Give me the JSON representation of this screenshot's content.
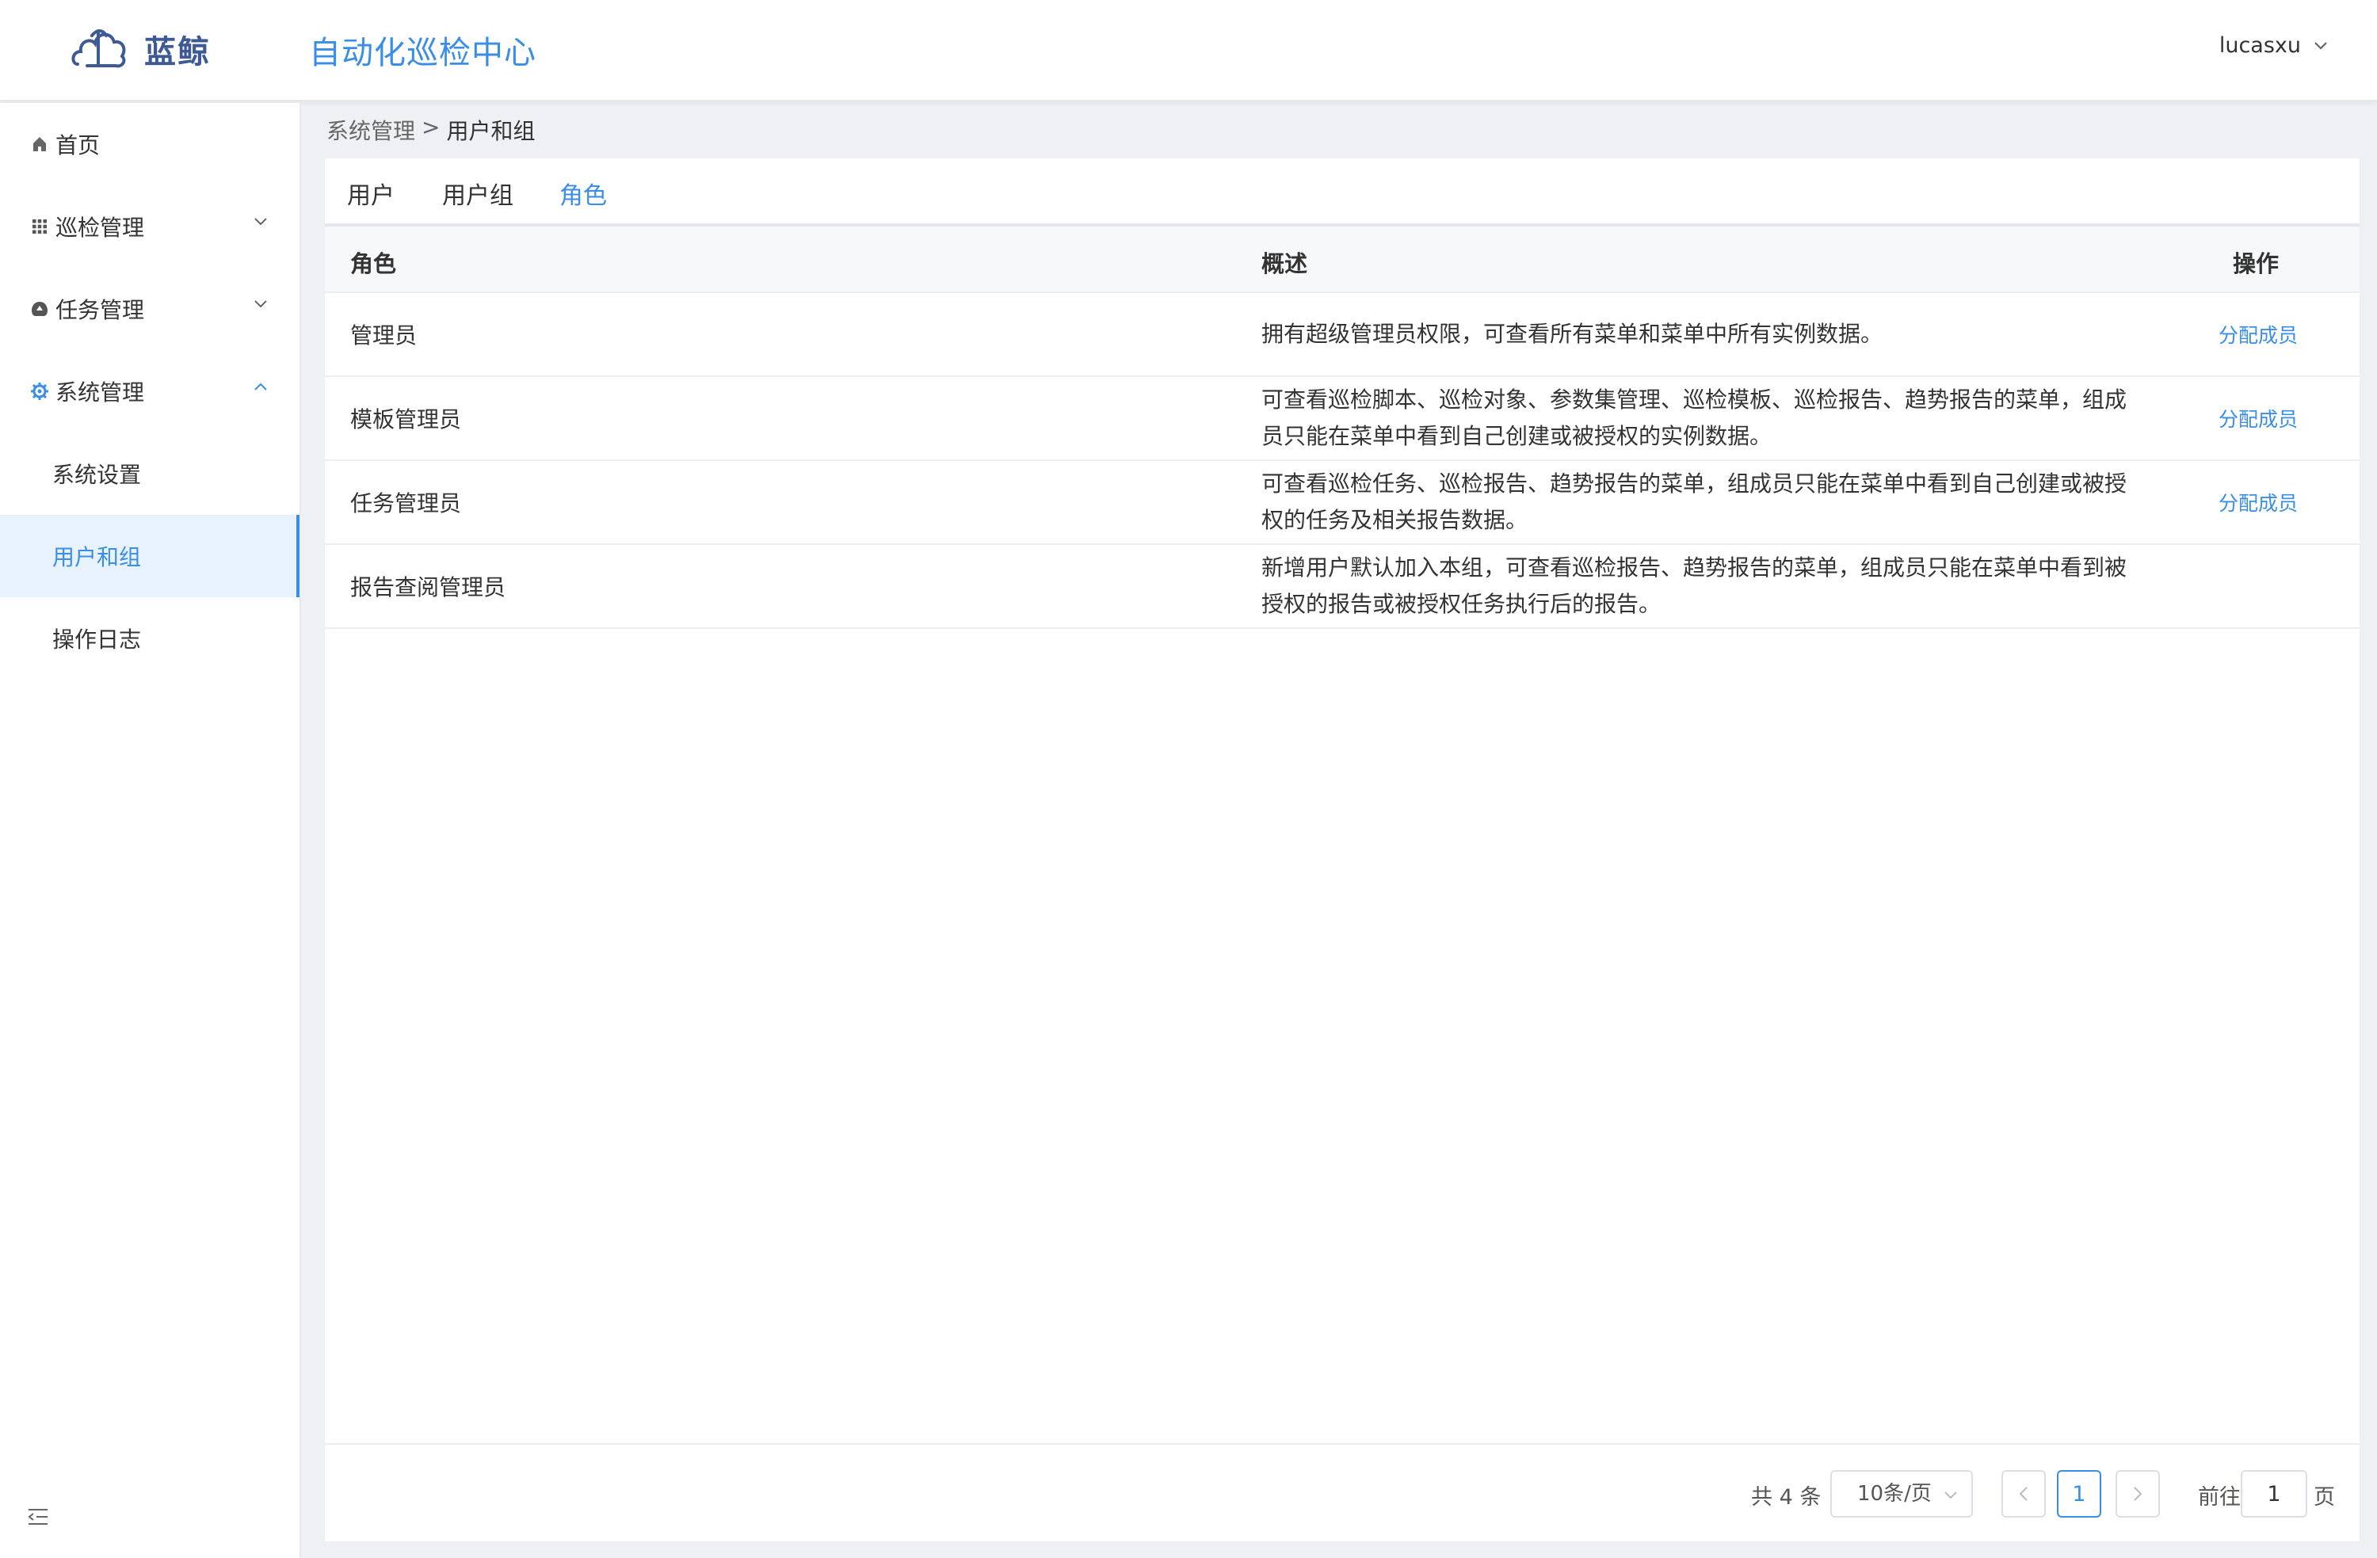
{
  "header": {
    "logo_text": "蓝鲸",
    "app_title": "自动化巡检中心",
    "username": "lucasxu"
  },
  "sidebar": {
    "items": [
      {
        "label": "首页",
        "icon": "home-icon"
      },
      {
        "label": "巡检管理",
        "icon": "grid-icon",
        "expanded": false
      },
      {
        "label": "任务管理",
        "icon": "task-icon",
        "expanded": false
      },
      {
        "label": "系统管理",
        "icon": "gear-icon",
        "expanded": true
      }
    ],
    "subitems": [
      {
        "label": "系统设置",
        "active": false
      },
      {
        "label": "用户和组",
        "active": true
      },
      {
        "label": "操作日志",
        "active": false
      }
    ]
  },
  "breadcrumb": {
    "parent": "系统管理",
    "separator": ">",
    "current": "用户和组"
  },
  "tabs": [
    {
      "label": "用户",
      "active": false
    },
    {
      "label": "用户组",
      "active": false
    },
    {
      "label": "角色",
      "active": true
    }
  ],
  "table": {
    "headers": {
      "role": "角色",
      "description": "概述",
      "action": "操作"
    },
    "rows": [
      {
        "role": "管理员",
        "description": "拥有超级管理员权限，可查看所有菜单和菜单中所有实例数据。",
        "action": "分配成员"
      },
      {
        "role": "模板管理员",
        "description": "可查看巡检脚本、巡检对象、参数集管理、巡检模板、巡检报告、趋势报告的菜单，组成员只能在菜单中看到自己创建或被授权的实例数据。",
        "action": "分配成员"
      },
      {
        "role": "任务管理员",
        "description": "可查看巡检任务、巡检报告、趋势报告的菜单，组成员只能在菜单中看到自己创建或被授权的任务及相关报告数据。",
        "action": "分配成员"
      },
      {
        "role": "报告查阅管理员",
        "description": "新增用户默认加入本组，可查看巡检报告、趋势报告的菜单，组成员只能在菜单中看到被授权的报告或被授权任务执行后的报告。",
        "action": ""
      }
    ]
  },
  "pagination": {
    "total": "共 4 条",
    "page_size": "10条/页",
    "current_page": "1",
    "goto_label": "前往",
    "goto_value": "1",
    "page_label": "页"
  },
  "colors": {
    "accent": "#3a8ee6",
    "logo": "#3d5a94",
    "active_bg": "#e8f2fd"
  }
}
